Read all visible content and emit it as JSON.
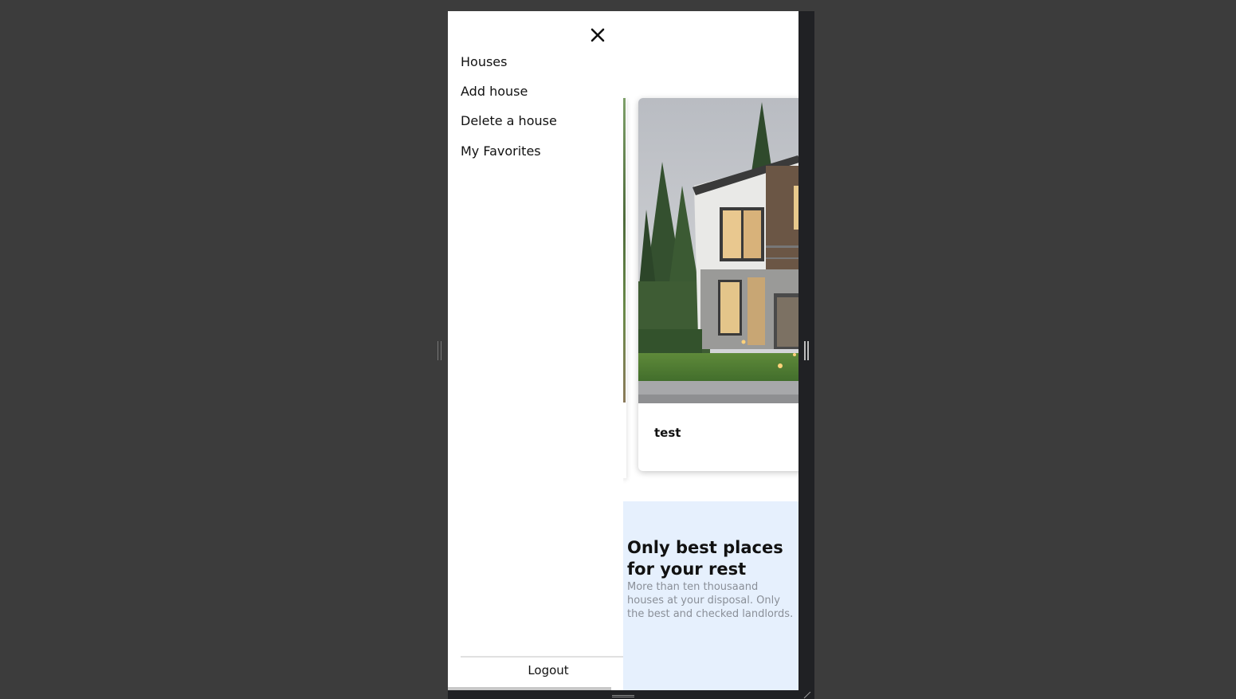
{
  "drawer": {
    "close_icon": "close-icon",
    "items": [
      {
        "label": "Houses"
      },
      {
        "label": "Add house"
      },
      {
        "label": "Delete a house"
      },
      {
        "label": "My Favorites"
      }
    ],
    "logout_label": "Logout"
  },
  "listing_card": {
    "title": "test"
  },
  "promo": {
    "title": "Only best places for your rest",
    "text": "More than ten thousaand houses at your disposal.  Only the best and checked landlords."
  },
  "colors": {
    "backdrop": "#3c3c3c",
    "promo_background": "#e6f0fd",
    "promo_text": "#8a8f98",
    "device_frame": "#202124"
  }
}
